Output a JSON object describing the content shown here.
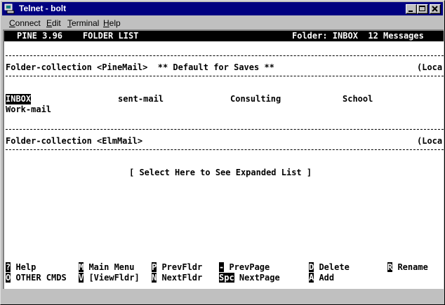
{
  "window": {
    "title": "Telnet - bolt"
  },
  "menubar": {
    "items": [
      {
        "label": "Connect"
      },
      {
        "label": "Edit"
      },
      {
        "label": "Terminal"
      },
      {
        "label": "Help"
      }
    ]
  },
  "terminal": {
    "header_left": "PINE 3.96    FOLDER LIST",
    "header_right": "Folder: INBOX  12 Messages",
    "collection1": {
      "label": "Folder-collection <PineMail>  ** Default for Saves **",
      "right": "(Loca"
    },
    "folders": [
      "INBOX",
      "sent-mail",
      "Consulting",
      "School",
      "Work-mail"
    ],
    "collection2": {
      "label": "Folder-collection <ElmMail>",
      "right": "(Loca"
    },
    "expand_prompt": "[ Select Here to See Expanded List ]",
    "commands_row1": [
      {
        "key": "?",
        "label": "Help"
      },
      {
        "key": "M",
        "label": "Main Menu"
      },
      {
        "key": "P",
        "label": "PrevFldr"
      },
      {
        "key": "-",
        "label": "PrevPage"
      },
      {
        "key": "D",
        "label": "Delete"
      },
      {
        "key": "R",
        "label": "Rename"
      }
    ],
    "commands_row2": [
      {
        "key": "O",
        "label": "OTHER CMDS"
      },
      {
        "key": "V",
        "label": "[ViewFldr]"
      },
      {
        "key": "N",
        "label": "NextFldr"
      },
      {
        "key": "Spc",
        "label": "NextPage"
      },
      {
        "key": "A",
        "label": "Add"
      }
    ]
  }
}
